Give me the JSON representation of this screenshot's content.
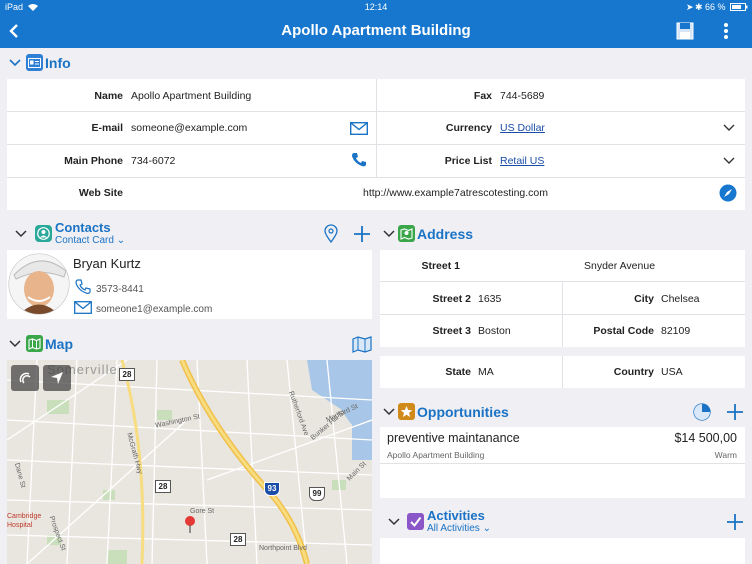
{
  "status": {
    "device": "iPad",
    "time": "12:14",
    "battery": "66 %"
  },
  "nav": {
    "title": "Apollo Apartment Building",
    "back_icon": "chevron-left-icon",
    "save_icon": "save-icon",
    "more_icon": "more-vertical-icon"
  },
  "info": {
    "title": "Info",
    "name_label": "Name",
    "name_value": "Apollo Apartment Building",
    "fax_label": "Fax",
    "fax_value": "744-5689",
    "email_label": "E-mail",
    "email_value": "someone@example.com",
    "currency_label": "Currency",
    "currency_value": "US Dollar",
    "phone_label": "Main Phone",
    "phone_value": "734-6072",
    "pricelist_label": "Price List",
    "pricelist_value": "Retail US",
    "website_label": "Web Site",
    "website_value": "http://www.example7atrescotesting.com"
  },
  "contacts": {
    "title": "Contacts",
    "view": "Contact Card",
    "name": "Bryan Kurtz",
    "phone": "3573-8441",
    "email": "someone1@example.com"
  },
  "map": {
    "title": "Map",
    "labels": [
      "Somerville",
      "Washington St",
      "McGrath Hwy",
      "Rutherford Ave",
      "Medford St",
      "Bunker Hill St",
      "Main St",
      "Gore St",
      "Northpoint Blvd",
      "Cambridge Hospital",
      "Prospect St",
      "Dane St"
    ],
    "shields": [
      "28",
      "28",
      "28",
      "93",
      "99"
    ]
  },
  "address": {
    "title": "Address",
    "street1_label": "Street 1",
    "street1_value": "Snyder Avenue",
    "street2_label": "Street 2",
    "street2_value": "1635",
    "city_label": "City",
    "city_value": "Chelsea",
    "street3_label": "Street 3",
    "street3_value": "Boston",
    "postal_label": "Postal Code",
    "postal_value": "82109",
    "state_label": "State",
    "state_value": "MA",
    "country_label": "Country",
    "country_value": "USA"
  },
  "opportunities": {
    "title": "Opportunities",
    "item_title": "preventive maintanance",
    "item_amount": "$14 500,00",
    "item_account": "Apollo Apartment Building",
    "item_rating": "Warm"
  },
  "activities": {
    "title": "Activities",
    "view": "All Activities"
  },
  "colors": {
    "accent": "#1777cf",
    "link": "#1a4da8",
    "background": "#efeff4"
  }
}
